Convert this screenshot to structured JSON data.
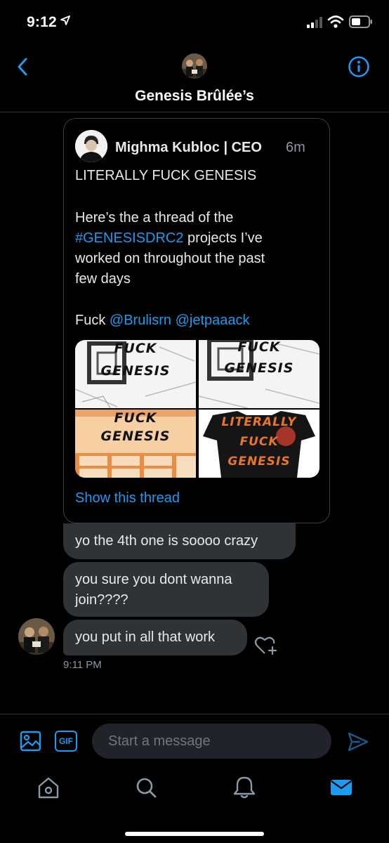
{
  "status_bar": {
    "time": "9:12",
    "icons": [
      "location-arrow-icon",
      "cellular-signal-icon",
      "wifi-icon",
      "battery-icon"
    ]
  },
  "header": {
    "title": "Genesis Brûlée’s",
    "icons": [
      "chevron-left-icon",
      "info-icon"
    ]
  },
  "shared_tweet": {
    "author": "Mighma Kubloc | CEO",
    "time": "6m",
    "line1": "LITERALLY FUCK GENESIS",
    "line2": "Here’s the a thread of the",
    "hashtag": "#GENESISDRC2",
    "line3_rest": " projects I’ve",
    "line4": "worked on throughout the past",
    "line5": "few days",
    "line6_prefix": "Fuck ",
    "mention1": "@Brulisrn",
    "mention2": "@jetpaaack",
    "media": [
      {
        "caption_top": "FUCK",
        "caption_bottom": "GENESIS"
      },
      {
        "caption_top": "FUCK",
        "caption_bottom": "GENESIS"
      },
      {
        "caption_top": "FUCK",
        "caption_bottom": "GENESIS"
      },
      {
        "caption_top": "LITERALLY",
        "caption_mid": "FUCK",
        "caption_bottom": "GENESIS"
      }
    ],
    "show_thread": "Show this thread"
  },
  "messages": [
    {
      "text": "yo the 4th one is soooo crazy"
    },
    {
      "line1": "you sure you dont wanna",
      "line2": "join????"
    },
    {
      "text": "you put in all that work"
    }
  ],
  "message_time": "9:11 PM",
  "compose": {
    "placeholder": "Start a message",
    "gif_label": "GIF"
  },
  "tabs": [
    "home-icon",
    "search-icon",
    "notifications-icon",
    "messages-icon"
  ],
  "colors": {
    "accent": "#1d9bf0",
    "bubble": "#2f3336",
    "background": "#000000",
    "orange": "#e8762b"
  }
}
